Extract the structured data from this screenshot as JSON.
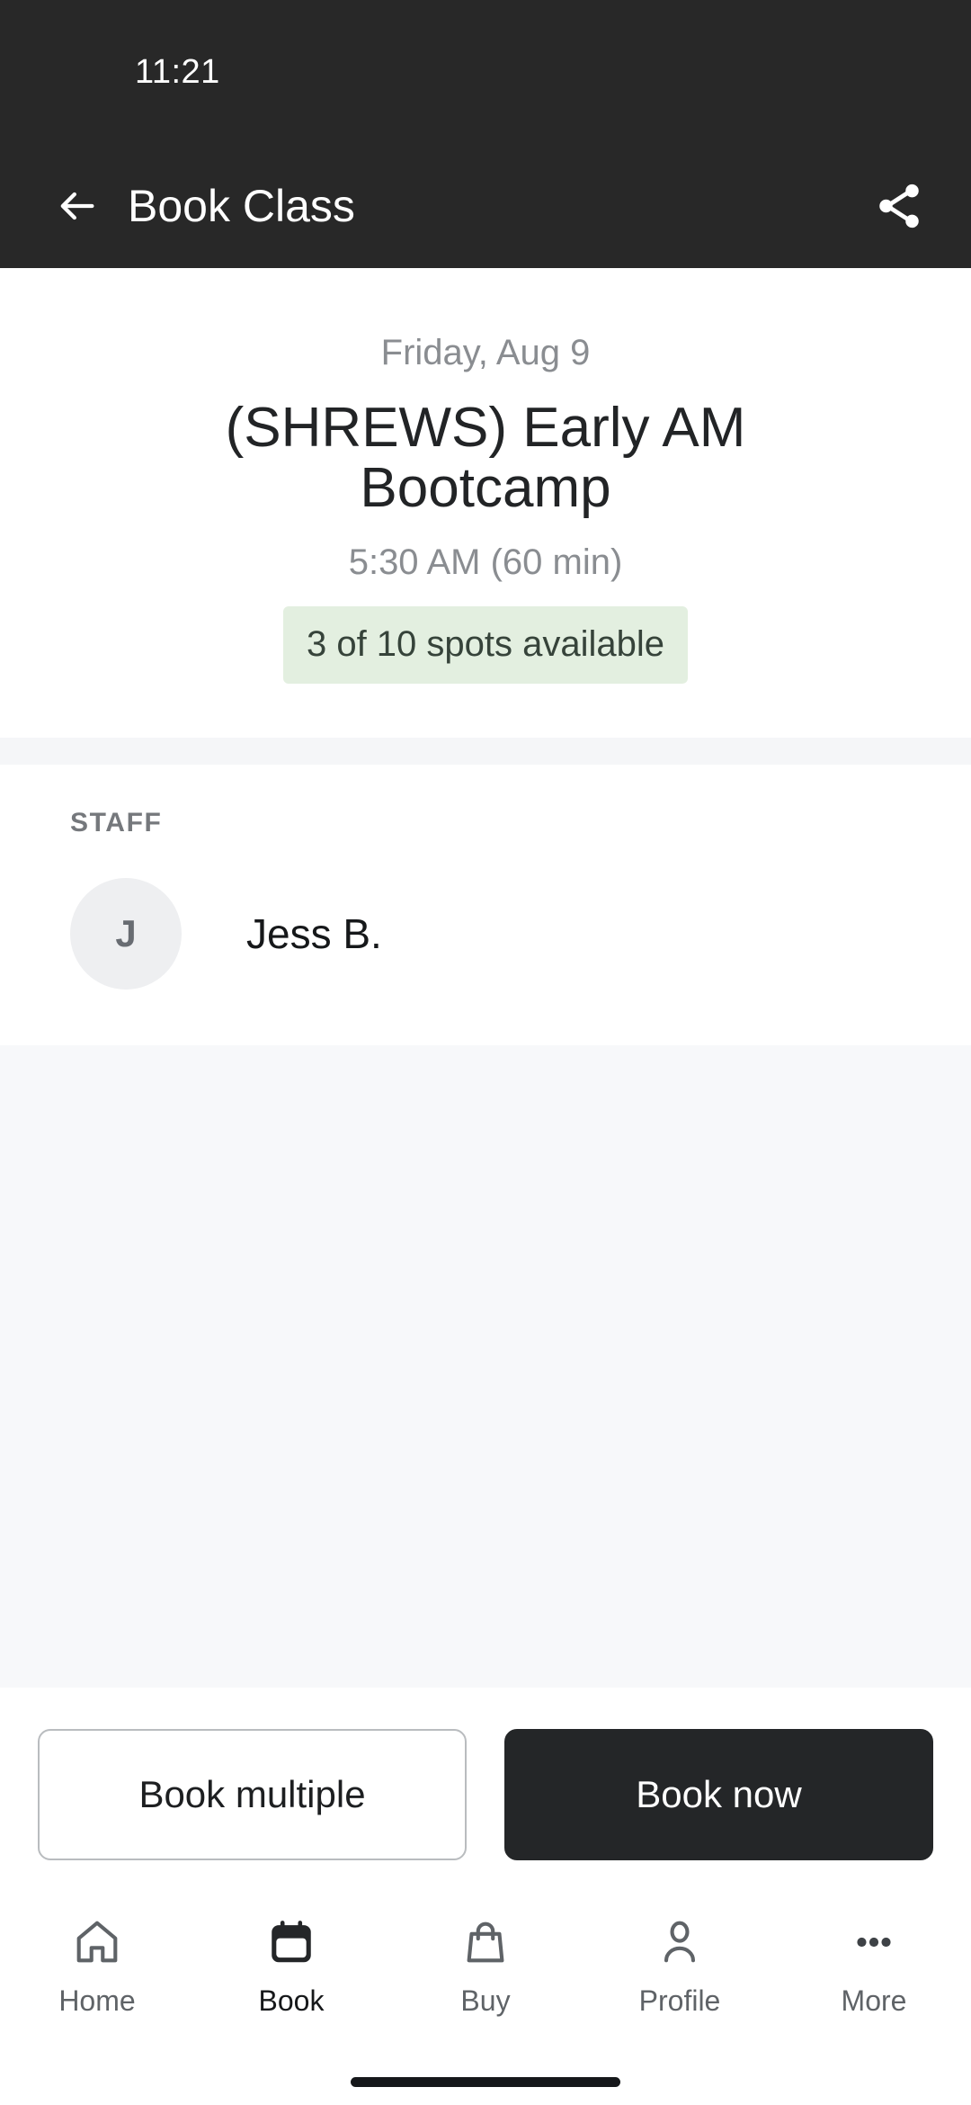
{
  "status_bar": {
    "time": "11:21"
  },
  "app_bar": {
    "title": "Book Class",
    "back_icon": "back-arrow-icon",
    "share_icon": "share-icon"
  },
  "class": {
    "date": "Friday, Aug 9",
    "title": "(SHREWS) Early AM Bootcamp",
    "time": "5:30 AM (60 min)",
    "availability": "3 of 10 spots available",
    "availability_bg": "#e3efe0",
    "availability_text_color": "#36433a"
  },
  "staff": {
    "section_label": "STAFF",
    "members": [
      {
        "initial": "J",
        "name": "Jess B."
      }
    ]
  },
  "actions": {
    "secondary_label": "Book multiple",
    "primary_label": "Book now",
    "primary_bg": "#242628"
  },
  "bottom_nav": {
    "items": [
      {
        "label": "Home",
        "icon": "home-icon",
        "active": false
      },
      {
        "label": "Book",
        "icon": "calendar-icon",
        "active": true
      },
      {
        "label": "Buy",
        "icon": "shopping-bag-icon",
        "active": false
      },
      {
        "label": "Profile",
        "icon": "person-icon",
        "active": false
      },
      {
        "label": "More",
        "icon": "more-dots-icon",
        "active": false
      }
    ]
  },
  "theme": {
    "header_bg": "#282828",
    "page_bg": "#ffffff",
    "filler_bg": "#f7f8fa"
  }
}
